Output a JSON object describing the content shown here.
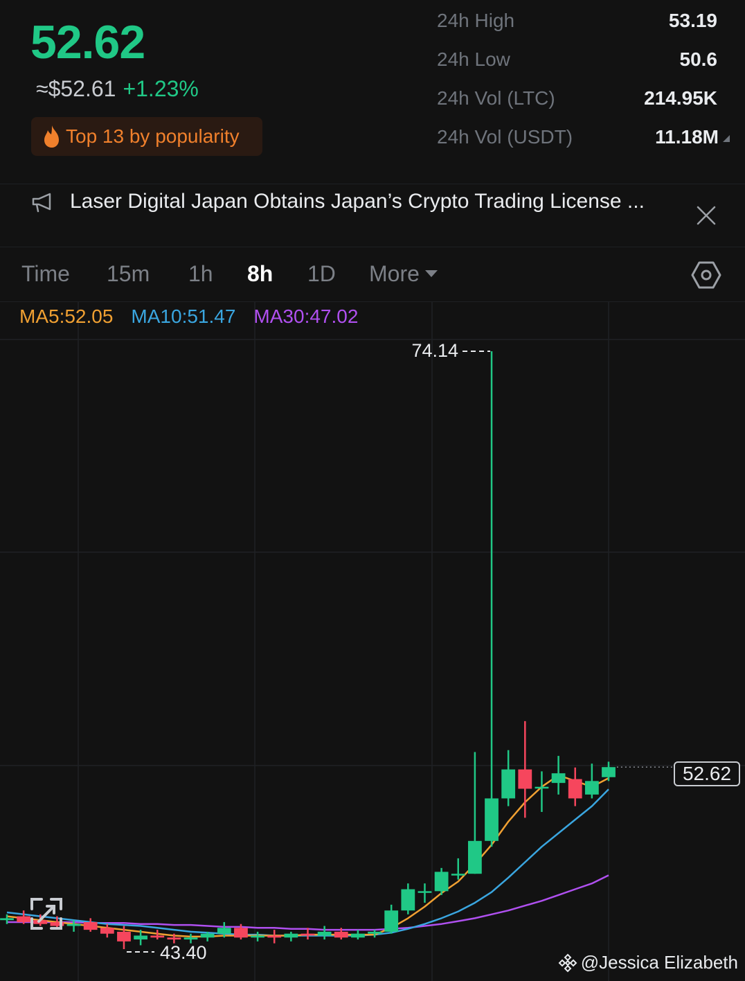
{
  "header": {
    "price": "52.62",
    "fiat_price": "≈$52.61",
    "change": "+1.23%",
    "popularity": "Top 13 by popularity",
    "stats": [
      {
        "label": "24h High",
        "value": "53.19"
      },
      {
        "label": "24h Low",
        "value": "50.6"
      },
      {
        "label": "24h Vol (LTC)",
        "value": "214.95K"
      },
      {
        "label": "24h Vol (USDT)",
        "value": "11.18M"
      }
    ]
  },
  "news": {
    "text": "Laser Digital Japan Obtains Japan’s Crypto Trading License ..."
  },
  "tabs": {
    "items": [
      "Time",
      "15m",
      "1h",
      "8h",
      "1D",
      "More"
    ],
    "active": "8h"
  },
  "indicators": {
    "ma5": "MA5:52.05",
    "ma10": "MA10:51.47",
    "ma30": "MA30:47.02"
  },
  "colors": {
    "up": "#20c886",
    "down": "#f6465d",
    "accent_orange": "#f0802c",
    "ma5": "#f0a032",
    "ma10": "#3aa6e0",
    "ma30": "#b050f0",
    "background": "#121212"
  },
  "chart_data": {
    "type": "candlestick",
    "high_label": "74.14",
    "low_label": "43.40",
    "last_price_label": "52.62",
    "candles": [
      {
        "o": 44.7,
        "h": 45.0,
        "l": 44.5,
        "c": 44.8
      },
      {
        "o": 44.9,
        "h": 45.2,
        "l": 44.5,
        "c": 44.6
      },
      {
        "o": 44.7,
        "h": 45.0,
        "l": 44.4,
        "c": 44.5
      },
      {
        "o": 44.6,
        "h": 44.9,
        "l": 44.3,
        "c": 44.4
      },
      {
        "o": 44.4,
        "h": 44.7,
        "l": 44.1,
        "c": 44.5
      },
      {
        "o": 44.6,
        "h": 44.8,
        "l": 44.1,
        "c": 44.2
      },
      {
        "o": 44.3,
        "h": 44.5,
        "l": 43.8,
        "c": 44.0
      },
      {
        "o": 44.1,
        "h": 44.4,
        "l": 43.2,
        "c": 43.6
      },
      {
        "o": 43.7,
        "h": 44.2,
        "l": 43.4,
        "c": 43.9
      },
      {
        "o": 43.9,
        "h": 44.2,
        "l": 43.7,
        "c": 43.8
      },
      {
        "o": 43.8,
        "h": 44.0,
        "l": 43.5,
        "c": 43.7
      },
      {
        "o": 43.7,
        "h": 44.0,
        "l": 43.5,
        "c": 43.8
      },
      {
        "o": 43.8,
        "h": 44.1,
        "l": 43.6,
        "c": 44.0
      },
      {
        "o": 44.0,
        "h": 44.6,
        "l": 43.8,
        "c": 44.3
      },
      {
        "o": 44.3,
        "h": 44.5,
        "l": 43.7,
        "c": 43.8
      },
      {
        "o": 43.8,
        "h": 44.1,
        "l": 43.6,
        "c": 43.9
      },
      {
        "o": 43.9,
        "h": 44.2,
        "l": 43.5,
        "c": 43.8
      },
      {
        "o": 43.8,
        "h": 44.1,
        "l": 43.6,
        "c": 44.0
      },
      {
        "o": 44.0,
        "h": 44.3,
        "l": 43.7,
        "c": 43.9
      },
      {
        "o": 43.9,
        "h": 44.4,
        "l": 43.7,
        "c": 44.1
      },
      {
        "o": 44.1,
        "h": 44.3,
        "l": 43.7,
        "c": 43.8
      },
      {
        "o": 43.8,
        "h": 44.2,
        "l": 43.7,
        "c": 44.0
      },
      {
        "o": 44.0,
        "h": 44.2,
        "l": 43.8,
        "c": 44.1
      },
      {
        "o": 44.1,
        "h": 45.5,
        "l": 44.0,
        "c": 45.2
      },
      {
        "o": 45.2,
        "h": 46.6,
        "l": 45.0,
        "c": 46.3
      },
      {
        "o": 46.2,
        "h": 46.6,
        "l": 45.6,
        "c": 46.2
      },
      {
        "o": 46.2,
        "h": 47.4,
        "l": 46.0,
        "c": 47.2
      },
      {
        "o": 47.1,
        "h": 47.9,
        "l": 46.8,
        "c": 47.1
      },
      {
        "o": 47.1,
        "h": 53.4,
        "l": 47.1,
        "c": 48.8
      },
      {
        "o": 48.8,
        "h": 74.14,
        "l": 48.5,
        "c": 51.0
      },
      {
        "o": 51.0,
        "h": 53.5,
        "l": 50.6,
        "c": 52.5
      },
      {
        "o": 52.5,
        "h": 55.0,
        "l": 50.0,
        "c": 51.5
      },
      {
        "o": 51.6,
        "h": 52.4,
        "l": 50.3,
        "c": 51.6
      },
      {
        "o": 51.8,
        "h": 53.2,
        "l": 51.2,
        "c": 52.3
      },
      {
        "o": 52.0,
        "h": 52.6,
        "l": 50.6,
        "c": 51.0
      },
      {
        "o": 51.2,
        "h": 52.8,
        "l": 51.0,
        "c": 51.9
      },
      {
        "o": 52.1,
        "h": 52.9,
        "l": 51.9,
        "c": 52.62
      }
    ],
    "ma5": [
      44.9,
      44.8,
      44.7,
      44.6,
      44.5,
      44.4,
      44.3,
      44.2,
      44.1,
      44.0,
      43.9,
      43.85,
      43.85,
      43.9,
      43.9,
      43.9,
      43.9,
      43.9,
      43.95,
      43.95,
      43.95,
      43.95,
      43.95,
      44.3,
      44.8,
      45.4,
      46.1,
      46.7,
      47.6,
      48.6,
      49.8,
      50.8,
      51.6,
      52.2,
      51.9,
      51.6,
      52.05
    ],
    "ma10": [
      45.1,
      45.0,
      44.9,
      44.8,
      44.7,
      44.6,
      44.5,
      44.45,
      44.4,
      44.3,
      44.2,
      44.1,
      44.05,
      44.0,
      43.95,
      43.95,
      43.9,
      43.9,
      43.9,
      43.9,
      43.9,
      43.9,
      43.95,
      44.05,
      44.25,
      44.5,
      44.8,
      45.15,
      45.6,
      46.15,
      46.9,
      47.7,
      48.5,
      49.2,
      49.9,
      50.6,
      51.47
    ],
    "ma30": [
      44.6,
      44.6,
      44.6,
      44.6,
      44.6,
      44.55,
      44.55,
      44.55,
      44.5,
      44.5,
      44.45,
      44.45,
      44.4,
      44.35,
      44.35,
      44.3,
      44.3,
      44.25,
      44.25,
      44.2,
      44.2,
      44.2,
      44.2,
      44.25,
      44.3,
      44.4,
      44.5,
      44.65,
      44.8,
      45.0,
      45.2,
      45.45,
      45.7,
      46.0,
      46.3,
      46.6,
      47.02
    ]
  },
  "watermark": {
    "handle": "@Jessica Elizabeth"
  }
}
